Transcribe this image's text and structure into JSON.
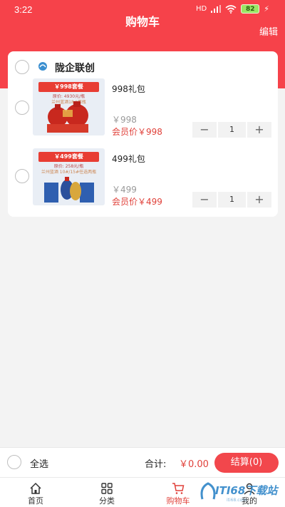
{
  "status_bar": {
    "time": "3:22",
    "signal": "HD",
    "battery": "82"
  },
  "header": {
    "title": "购物车",
    "edit_label": "编辑"
  },
  "shop": {
    "name": "陇企联创"
  },
  "products": [
    {
      "name": "998礼包",
      "price": "￥998",
      "member_price": "会员价￥998",
      "quantity": "1",
      "thumb_banner": "￥998套餐",
      "thumb_sub": "原价: 4930元/瓶",
      "thumb_sub2": "兰州蓝酒18#两瓶"
    },
    {
      "name": "499礼包",
      "price": "￥499",
      "member_price": "会员价￥499",
      "quantity": "1",
      "thumb_banner": "￥499套餐",
      "thumb_sub": "原价: 258元/瓶",
      "thumb_sub2": "兰州蓝酒 10#/15#任选两瓶"
    }
  ],
  "stepper": {
    "minus": "−",
    "plus": "+"
  },
  "bottom_bar": {
    "select_all": "全选",
    "total_label": "合计:",
    "total_value": "￥0.00",
    "checkout": "结算(0)"
  },
  "tabs": [
    {
      "label": "首页",
      "icon": "home-icon"
    },
    {
      "label": "分类",
      "icon": "category-icon"
    },
    {
      "label": "购物车",
      "icon": "cart-icon"
    },
    {
      "label": "我的",
      "icon": "user-icon"
    }
  ],
  "watermark": {
    "text": "ITI68下载站",
    "sub": "iti68.com"
  },
  "colors": {
    "accent": "#f6424a",
    "price_red": "#e0413a"
  }
}
